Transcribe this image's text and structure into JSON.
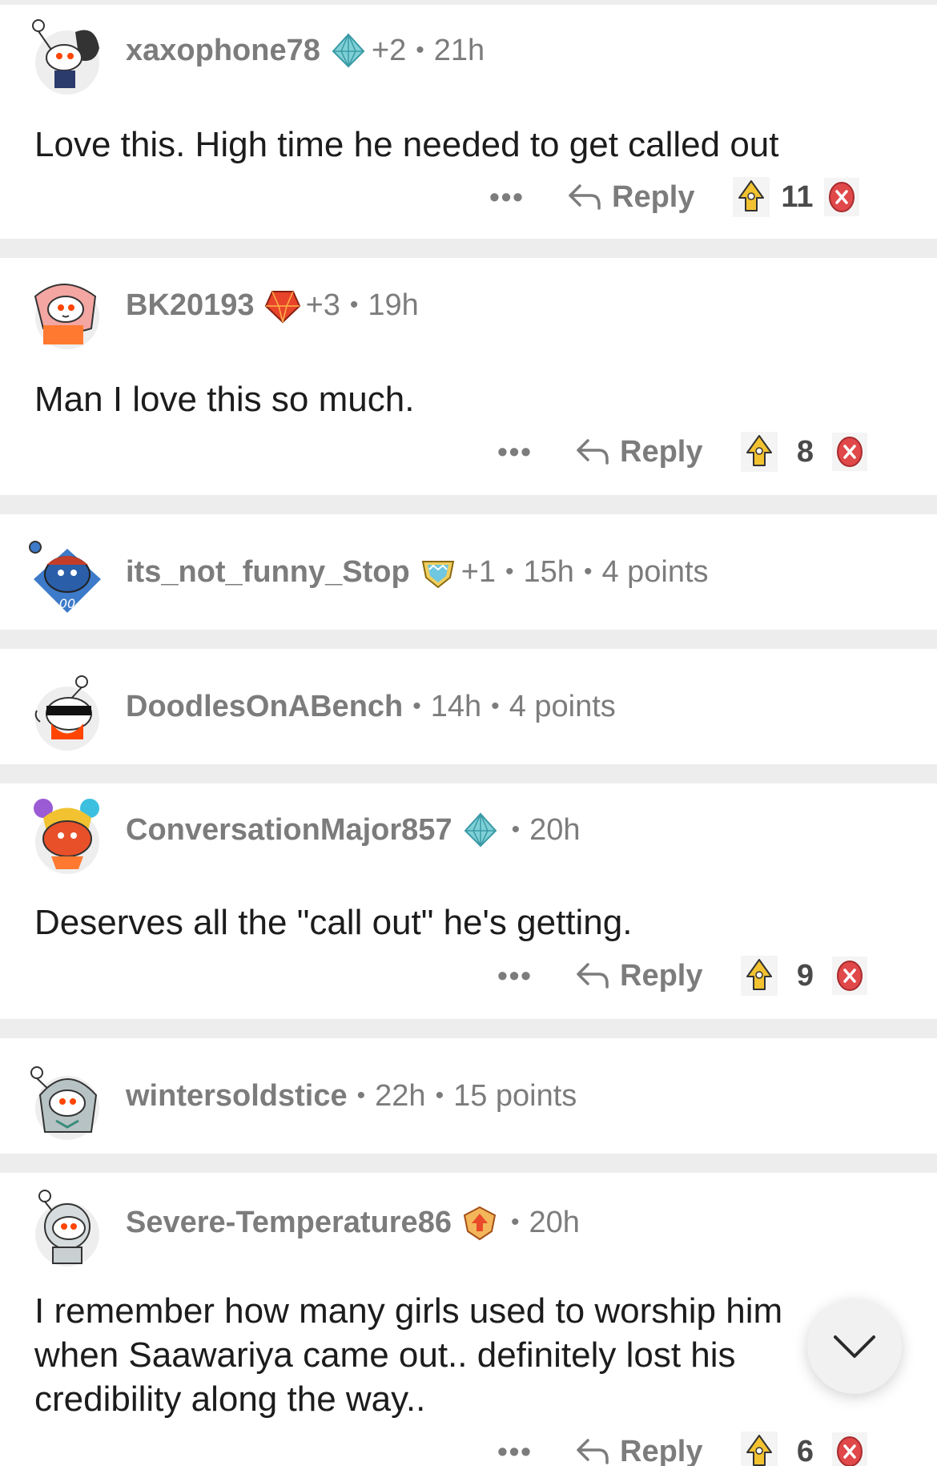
{
  "comments": [
    {
      "username": "xaxophone78",
      "flair_icon": "crystal-diamond-icon",
      "karma": "+2",
      "time": "21h",
      "body": "Love this. High time he needed to get called out",
      "reply_label": "Reply",
      "score": "11"
    },
    {
      "username": "BK20193",
      "flair_icon": "ruby-gem-icon",
      "karma": "+3",
      "time": "19h",
      "body": "Man I love this so much.",
      "reply_label": "Reply",
      "score": "8"
    },
    {
      "username": "its_not_funny_Stop",
      "flair_icon": "shield-crown-icon",
      "karma": "+1",
      "time": "15h",
      "points": "4 points",
      "collapsed": true
    },
    {
      "username": "DoodlesOnABench",
      "time": "14h",
      "points": "4 points",
      "collapsed": true
    },
    {
      "username": "ConversationMajor857",
      "flair_icon": "crystal-diamond-icon",
      "time": "20h",
      "body": "Deserves all the \"call out\" he's getting.",
      "reply_label": "Reply",
      "score": "9"
    },
    {
      "username": "wintersoldstice",
      "time": "22h",
      "points": "15 points",
      "collapsed": true
    },
    {
      "username": "Severe-Temperature86",
      "flair_icon": "arrow-badge-icon",
      "time": "20h",
      "body": "I remember how many girls used to worship him when Saawariya came out.. definitely lost his credibility along the way..",
      "reply_label": "Reply",
      "score": "6"
    }
  ],
  "colors": {
    "divider": "#ededed",
    "meta_text": "#7c7c7c",
    "body_text": "#1c1c1c",
    "downvote": "#e0484a",
    "upvote": "#f2c230"
  }
}
